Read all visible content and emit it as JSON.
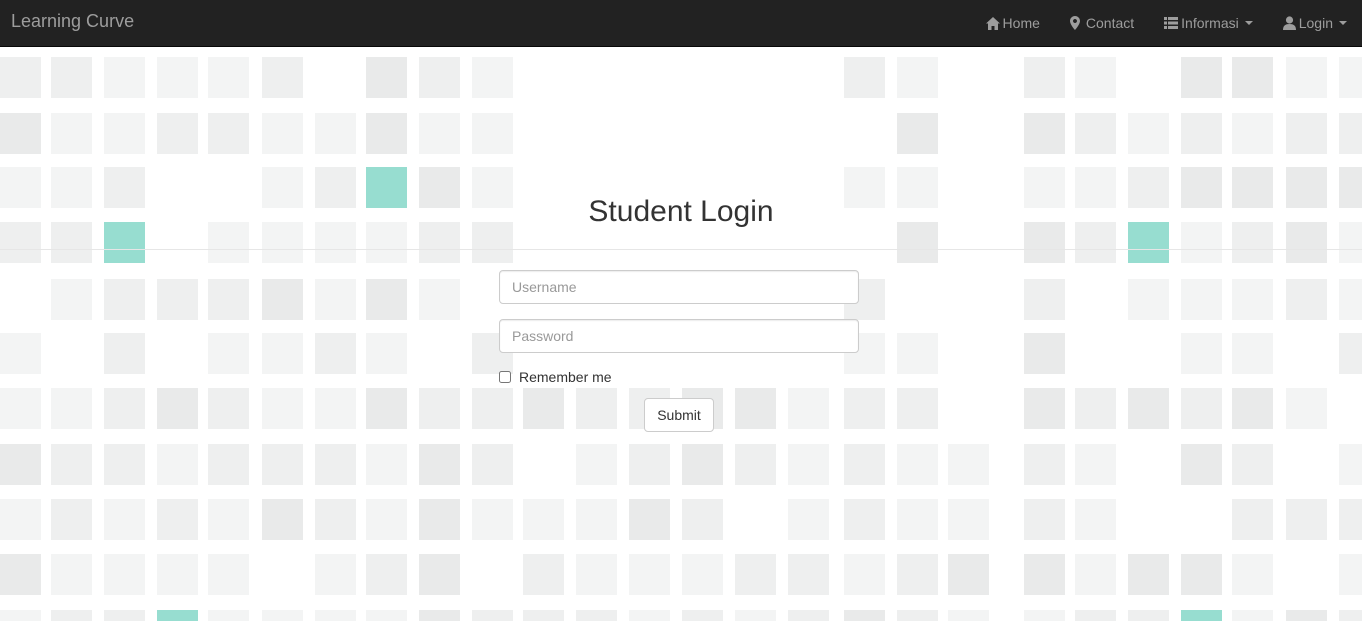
{
  "navbar": {
    "brand": "Learning Curve",
    "items": [
      {
        "label": "Home",
        "icon": "home-icon",
        "dropdown": false
      },
      {
        "label": "Contact",
        "icon": "map-marker-icon",
        "dropdown": false
      },
      {
        "label": "Informasi",
        "icon": "list-icon",
        "dropdown": true
      },
      {
        "label": "Login",
        "icon": "user-icon",
        "dropdown": true
      }
    ]
  },
  "login": {
    "title": "Student Login",
    "username_placeholder": "Username",
    "password_placeholder": "Password",
    "remember_label": "Remember me",
    "submit_label": "Submit"
  },
  "colors": {
    "navbar_bg": "#222222",
    "nav_text": "#9d9d9d",
    "tile_accent": "#97ddd0",
    "tile_light": "#f3f4f4",
    "tile_mid": "#e9eaea"
  }
}
